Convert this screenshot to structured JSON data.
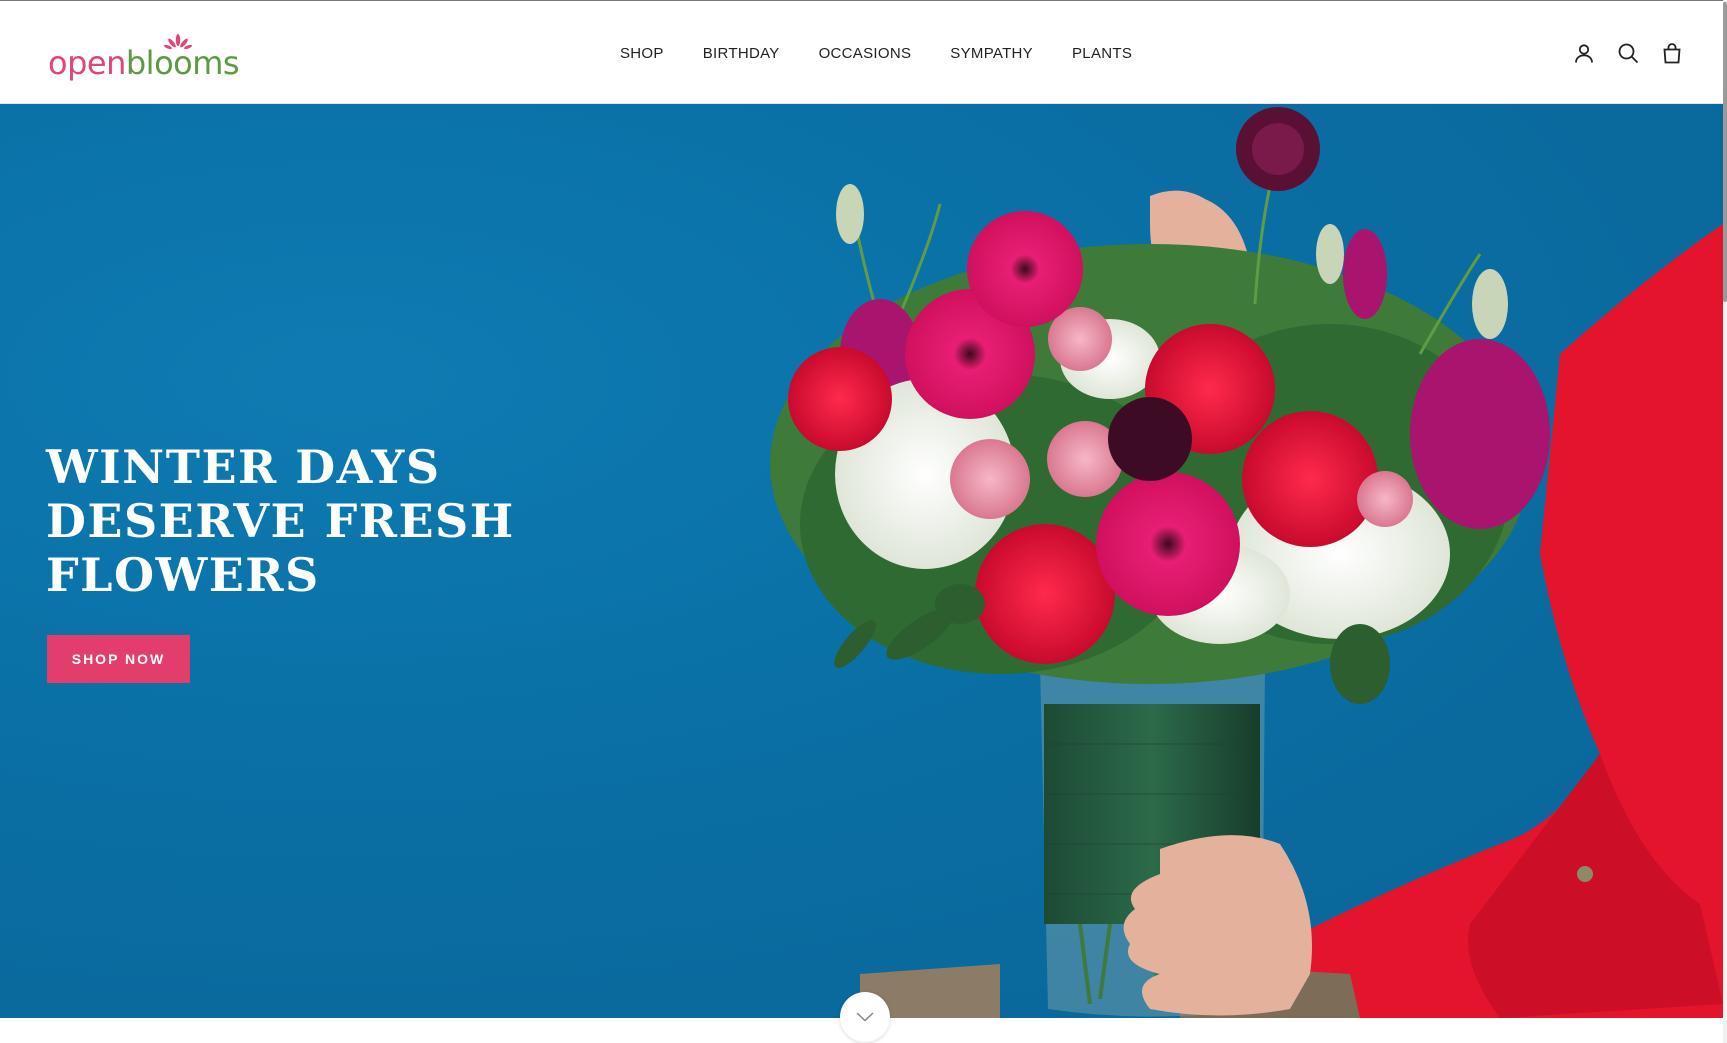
{
  "brand": {
    "logo_open": "open",
    "logo_blooms": "blooms",
    "color_pink": "#e0457b",
    "color_green": "#5e9a44"
  },
  "nav": {
    "items": [
      {
        "label": "SHOP"
      },
      {
        "label": "BIRTHDAY"
      },
      {
        "label": "OCCASIONS"
      },
      {
        "label": "SYMPATHY"
      },
      {
        "label": "PLANTS"
      }
    ]
  },
  "header_icons": [
    "account-icon",
    "search-icon",
    "cart-bag-icon"
  ],
  "hero": {
    "title_lines": [
      "WINTER DAYS",
      "DESERVE FRESH",
      "FLOWERS"
    ],
    "cta_label": "SHOP NOW",
    "cta_color": "#e33e6b",
    "background_color": "#0a6fa4"
  },
  "scroll_icon": "chevron-down-icon"
}
